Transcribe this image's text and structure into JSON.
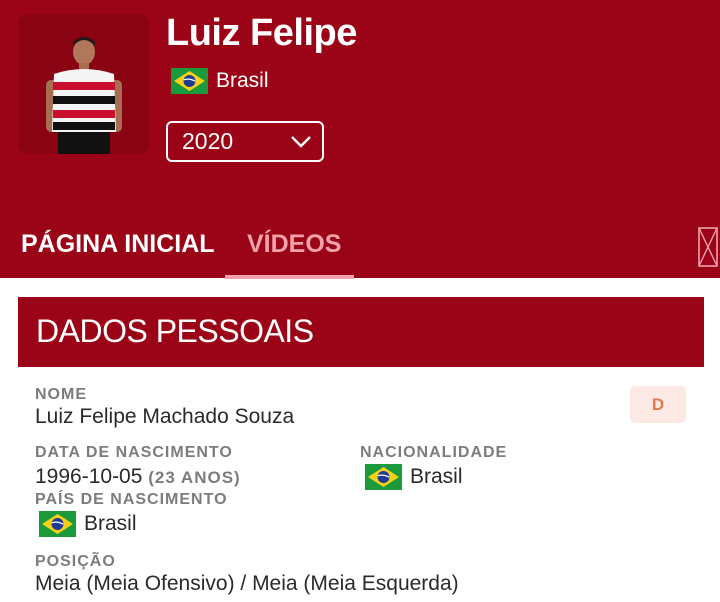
{
  "player": {
    "name": "Luiz Felipe",
    "country": "Brasil"
  },
  "season_select": {
    "selected": "2020"
  },
  "tabs": [
    {
      "label": "PÁGINA INICIAL",
      "active": true
    },
    {
      "label": "VÍDEOS",
      "active": false
    }
  ],
  "section": {
    "title": "DADOS PESSOAIS"
  },
  "personal": {
    "name_label": "NOME",
    "name_value": "Luiz Felipe Machado Souza",
    "position_badge": "D",
    "birth_label": "DATA DE NASCIMENTO",
    "birth_value": "1996-10-05",
    "age_note": "(23 ANOS)",
    "nationality_label": "NACIONALIDADE",
    "nationality_value": "Brasil",
    "birth_country_label": "PAÍS DE NASCIMENTO",
    "birth_country_value": "Brasil",
    "position_label": "POSIÇÃO",
    "position_value": "Meia (Meia Ofensivo) / Meia (Meia Esquerda)"
  },
  "colors": {
    "primary": "#9b0417",
    "tab_inactive": "#f2a2aa",
    "badge_bg": "#fde9e3",
    "badge_text": "#e07a4c"
  },
  "icons": {
    "flag": "brazil-flag-icon",
    "dropdown": "chevron-down-icon",
    "more": "more-tabs-icon"
  }
}
